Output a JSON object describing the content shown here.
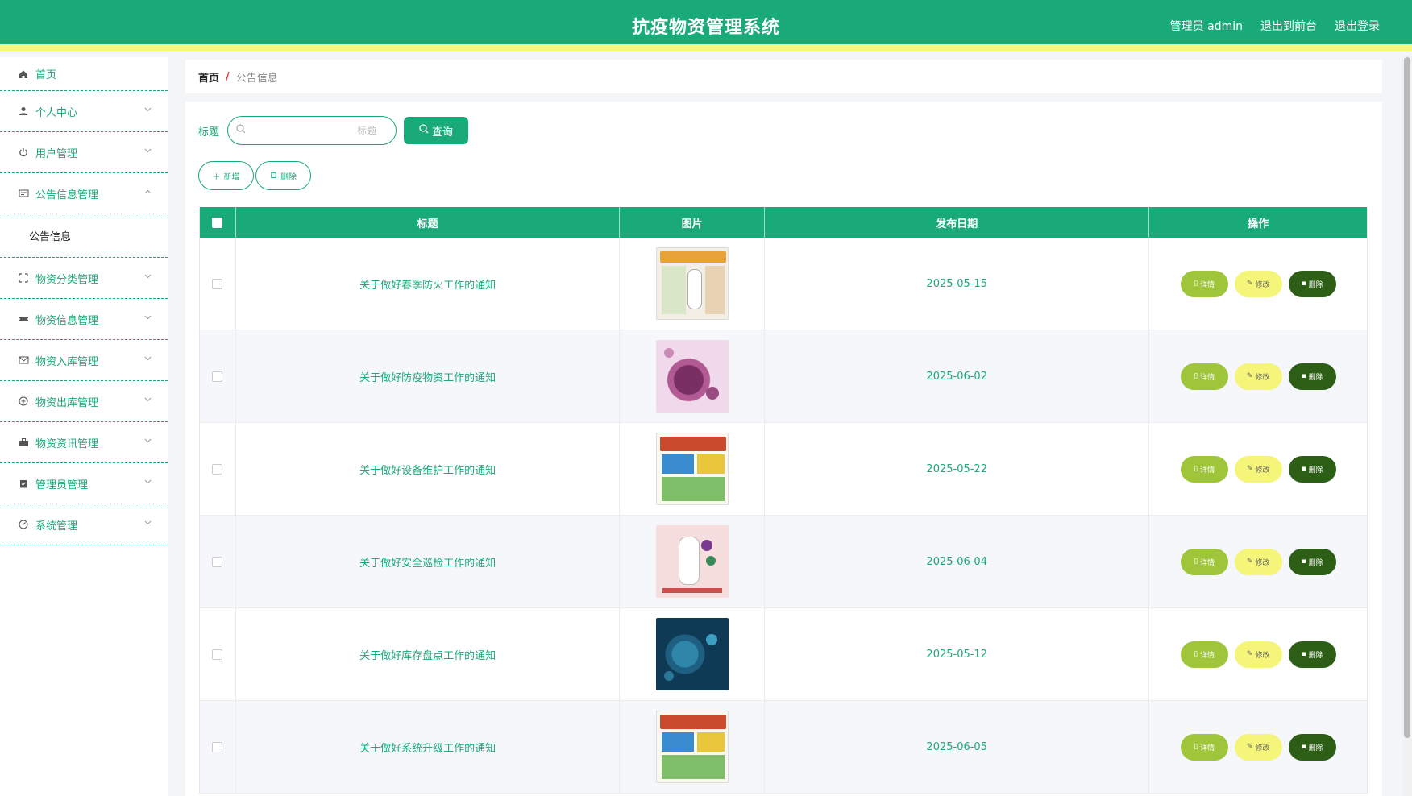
{
  "header": {
    "title": "抗疫物资管理系统",
    "user": "管理员 admin",
    "to_front": "退出到前台",
    "logout": "退出登录"
  },
  "sidebar": {
    "items": [
      {
        "label": "首页",
        "icon": "home-icon"
      },
      {
        "label": "个人中心",
        "icon": "user-icon"
      },
      {
        "label": "用户管理",
        "icon": "power-icon"
      },
      {
        "label": "公告信息管理",
        "icon": "notice-icon"
      },
      {
        "label": "物资分类管理",
        "icon": "scan-icon"
      },
      {
        "label": "物资信息管理",
        "icon": "ticket-icon"
      },
      {
        "label": "物资入库管理",
        "icon": "mail-icon"
      },
      {
        "label": "物资出库管理",
        "icon": "circle-plus-icon"
      },
      {
        "label": "物资资讯管理",
        "icon": "briefcase-icon"
      },
      {
        "label": "管理员管理",
        "icon": "clipboard-icon"
      },
      {
        "label": "系统管理",
        "icon": "gauge-icon"
      }
    ],
    "sub_item": "公告信息"
  },
  "breadcrumb": {
    "home": "首页",
    "separator": "/",
    "current": "公告信息"
  },
  "search": {
    "label": "标题",
    "placeholder": "标题",
    "value": "",
    "button": "查询"
  },
  "actions": {
    "add": "新增",
    "delete": "删除"
  },
  "table": {
    "columns": [
      "标题",
      "图片",
      "发布日期",
      "操作"
    ],
    "rows": [
      {
        "title": "关于做好春季防火工作的通知",
        "date": "2025-05-15",
        "image": "poster-prevent-virus"
      },
      {
        "title": "关于做好防疫物资工作的通知",
        "date": "2025-06-02",
        "image": "virus-pink"
      },
      {
        "title": "关于做好设备维护工作的通知",
        "date": "2025-05-22",
        "image": "poster-fight-virus"
      },
      {
        "title": "关于做好安全巡检工作的通知",
        "date": "2025-06-04",
        "image": "doctor-illustration"
      },
      {
        "title": "关于做好库存盘点工作的通知",
        "date": "2025-05-12",
        "image": "virus-blue"
      },
      {
        "title": "关于做好系统升级工作的通知",
        "date": "2025-06-05",
        "image": "poster-fight-virus"
      }
    ],
    "op_detail": "详情",
    "op_edit": "修改",
    "op_delete": "删除"
  },
  "colors": {
    "primary": "#1aa979",
    "accent_yellow": "#f7f77a",
    "detail_btn": "#9fc63a",
    "edit_btn": "#f5f57a",
    "delete_btn": "#2d5e16"
  }
}
